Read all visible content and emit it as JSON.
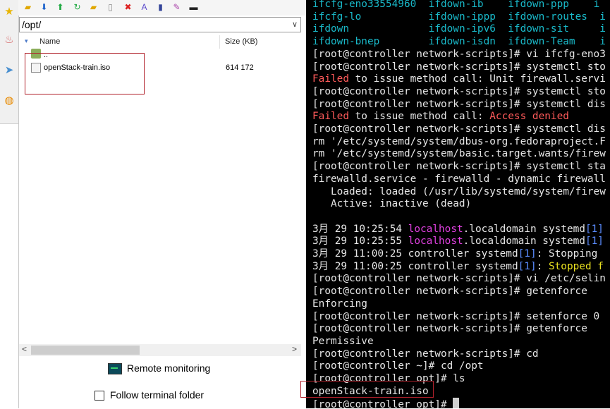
{
  "left_panel": {
    "path": "/opt/",
    "columns": {
      "name": "Name",
      "size": "Size (KB)"
    },
    "rows": [
      {
        "name": "..",
        "size": ""
      },
      {
        "name": "openStack-train.iso",
        "size": "614 172"
      }
    ],
    "remote_monitoring": "Remote monitoring",
    "follow_terminal": "Follow terminal folder"
  },
  "terminal": {
    "lines": [
      [
        {
          "t": "ifcfg-eno33554960",
          "c": "cyan"
        },
        {
          "t": "  "
        },
        {
          "t": "ifdown-ib",
          "c": "cyan"
        },
        {
          "t": "    "
        },
        {
          "t": "ifdown-ppp",
          "c": "cyan"
        },
        {
          "t": "    "
        },
        {
          "t": "i",
          "c": "cyan"
        }
      ],
      [
        {
          "t": "ifcfg-lo",
          "c": "cyan"
        },
        {
          "t": "           "
        },
        {
          "t": "ifdown-ippp",
          "c": "cyan"
        },
        {
          "t": "  "
        },
        {
          "t": "ifdown-routes",
          "c": "cyan"
        },
        {
          "t": "  "
        },
        {
          "t": "i",
          "c": "cyan"
        }
      ],
      [
        {
          "t": "ifdown",
          "c": "cyan"
        },
        {
          "t": "             "
        },
        {
          "t": "ifdown-ipv6",
          "c": "cyan"
        },
        {
          "t": "  "
        },
        {
          "t": "ifdown-sit",
          "c": "cyan"
        },
        {
          "t": "     "
        },
        {
          "t": "i",
          "c": "cyan"
        }
      ],
      [
        {
          "t": "ifdown-bnep",
          "c": "cyan"
        },
        {
          "t": "        "
        },
        {
          "t": "ifdown-isdn",
          "c": "cyan"
        },
        {
          "t": "  "
        },
        {
          "t": "ifdown-Team",
          "c": "cyan"
        },
        {
          "t": "    "
        },
        {
          "t": "i",
          "c": "cyan"
        }
      ],
      [
        {
          "t": "[root@controller network-scripts]# vi ifcfg-eno3"
        }
      ],
      [
        {
          "t": "[root@controller network-scripts]# systemctl sto"
        }
      ],
      [
        {
          "t": "Failed",
          "c": "red"
        },
        {
          "t": " to issue method call: Unit firewall.servi"
        }
      ],
      [
        {
          "t": "[root@controller network-scripts]# systemctl sto"
        }
      ],
      [
        {
          "t": "[root@controller network-scripts]# systemctl dis"
        }
      ],
      [
        {
          "t": "Failed",
          "c": "red"
        },
        {
          "t": " to issue method call: "
        },
        {
          "t": "Access denied",
          "c": "red"
        }
      ],
      [
        {
          "t": "[root@controller network-scripts]# systemctl dis"
        }
      ],
      [
        {
          "t": "rm '/etc/systemd/system/dbus-org.fedoraproject.F"
        }
      ],
      [
        {
          "t": "rm '/etc/systemd/system/basic.target.wants/firew"
        }
      ],
      [
        {
          "t": "[root@controller network-scripts]# systemctl sta"
        }
      ],
      [
        {
          "t": "firewalld.service - firewalld - dynamic firewall"
        }
      ],
      [
        {
          "t": "   Loaded: loaded (/usr/lib/systemd/system/firew"
        }
      ],
      [
        {
          "t": "   Active: inactive (dead)"
        }
      ],
      [
        {
          "t": ""
        }
      ],
      [
        {
          "t": "3月 29 10:25:54 "
        },
        {
          "t": "localhost",
          "c": "mag"
        },
        {
          "t": ".localdomain systemd"
        },
        {
          "t": "[1]",
          "c": "blu"
        }
      ],
      [
        {
          "t": "3月 29 10:25:55 "
        },
        {
          "t": "localhost",
          "c": "mag"
        },
        {
          "t": ".localdomain systemd"
        },
        {
          "t": "[1]",
          "c": "blu"
        }
      ],
      [
        {
          "t": "3月 29 11:00:25 controller systemd"
        },
        {
          "t": "[1]",
          "c": "blu"
        },
        {
          "t": ": Stopping "
        }
      ],
      [
        {
          "t": "3月 29 11:00:25 controller systemd"
        },
        {
          "t": "[1]",
          "c": "blu"
        },
        {
          "t": ": "
        },
        {
          "t": "Stopped f",
          "c": "yel"
        }
      ],
      [
        {
          "t": "[root@controller network-scripts]# vi /etc/selin"
        }
      ],
      [
        {
          "t": "[root@controller network-scripts]# getenforce"
        }
      ],
      [
        {
          "t": "Enforcing"
        }
      ],
      [
        {
          "t": "[root@controller network-scripts]# setenforce 0"
        }
      ],
      [
        {
          "t": "[root@controller network-scripts]# getenforce"
        }
      ],
      [
        {
          "t": "Permissive"
        }
      ],
      [
        {
          "t": "[root@controller network-scripts]# cd"
        }
      ],
      [
        {
          "t": "[root@controller ~]# cd /opt"
        }
      ],
      [
        {
          "t": "[root@controller opt]# ls"
        }
      ],
      [
        {
          "t": "openStack-train.iso"
        }
      ],
      [
        {
          "t": "[root@controller opt]# "
        },
        {
          "t": "",
          "cursor": true
        }
      ]
    ]
  },
  "colors": {
    "terminal_bg": "#000000",
    "cyan": "#19b8c8",
    "error": "#ff5a5a",
    "highlight_box": "#b0202a"
  }
}
